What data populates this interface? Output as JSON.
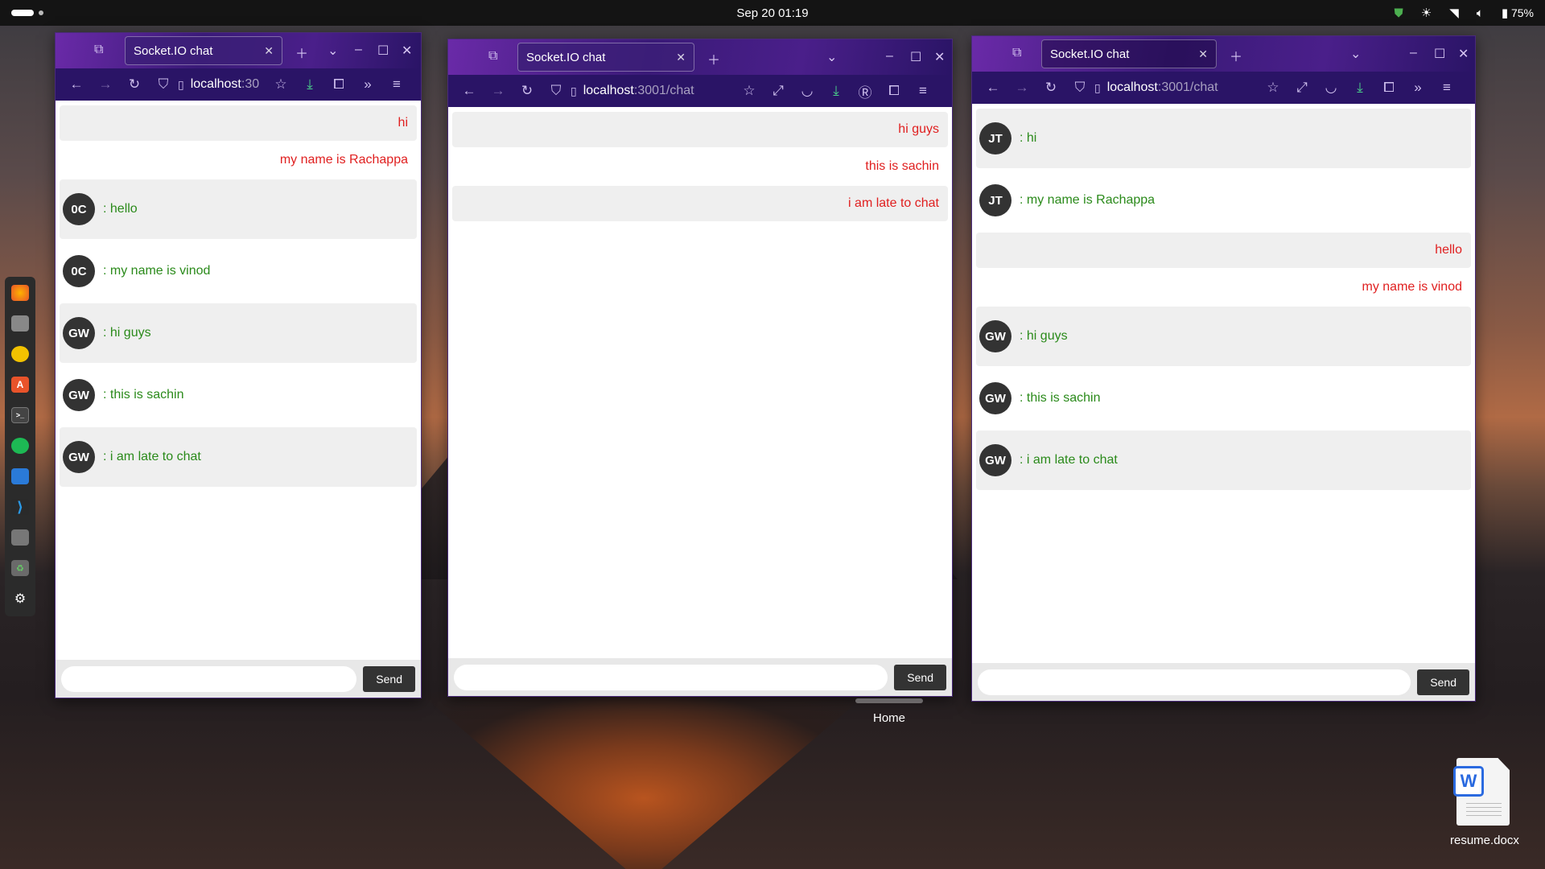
{
  "topbar": {
    "datetime": "Sep 20  01:19",
    "battery": "75%"
  },
  "colors": {
    "own_message": "#e02020",
    "other_message": "#2a8a1a",
    "avatar_bg": "#333333",
    "send_bg": "#333333"
  },
  "windows": [
    {
      "tab_title": "Socket.IO chat",
      "url_host": "localhost",
      "url_rest": ":30",
      "messages": [
        {
          "own": true,
          "text": "hi",
          "shade": true
        },
        {
          "own": true,
          "text": "my name is Rachappa",
          "shade": false
        },
        {
          "own": false,
          "avatar": "0C",
          "text": ": hello",
          "shade": true
        },
        {
          "own": false,
          "avatar": "0C",
          "text": ": my name is vinod",
          "shade": false
        },
        {
          "own": false,
          "avatar": "GW",
          "text": ": hi guys",
          "shade": true
        },
        {
          "own": false,
          "avatar": "GW",
          "text": ": this is sachin",
          "shade": false
        },
        {
          "own": false,
          "avatar": "GW",
          "text": ": i am late to chat",
          "shade": true
        }
      ],
      "send_label": "Send"
    },
    {
      "tab_title": "Socket.IO chat",
      "url_host": "localhost",
      "url_rest": ":3001/chat",
      "messages": [
        {
          "own": true,
          "text": "hi guys",
          "shade": true
        },
        {
          "own": true,
          "text": "this is sachin",
          "shade": false
        },
        {
          "own": true,
          "text": "i am late to chat",
          "shade": true
        }
      ],
      "send_label": "Send"
    },
    {
      "tab_title": "Socket.IO chat",
      "url_host": "localhost",
      "url_rest": ":3001/chat",
      "messages": [
        {
          "own": false,
          "avatar": "JT",
          "text": ": hi",
          "shade": true
        },
        {
          "own": false,
          "avatar": "JT",
          "text": ": my name is Rachappa",
          "shade": false
        },
        {
          "own": true,
          "text": "hello",
          "shade": true
        },
        {
          "own": true,
          "text": "my name is vinod",
          "shade": false
        },
        {
          "own": false,
          "avatar": "GW",
          "text": ": hi guys",
          "shade": true
        },
        {
          "own": false,
          "avatar": "GW",
          "text": ": this is sachin",
          "shade": false
        },
        {
          "own": false,
          "avatar": "GW",
          "text": ": i am late to chat",
          "shade": true
        }
      ],
      "send_label": "Send"
    }
  ],
  "dock": [
    "firefox-icon",
    "files-icon",
    "rhythmbox-icon",
    "app-center-icon",
    "terminal-icon",
    "spotify-icon",
    "monitor-icon",
    "vscode-icon",
    "disk-icon",
    "trash-icon",
    "show-apps-icon"
  ],
  "desktop": {
    "home_label": "Home",
    "file_label": "resume.docx",
    "file_icon_letter": "W"
  }
}
